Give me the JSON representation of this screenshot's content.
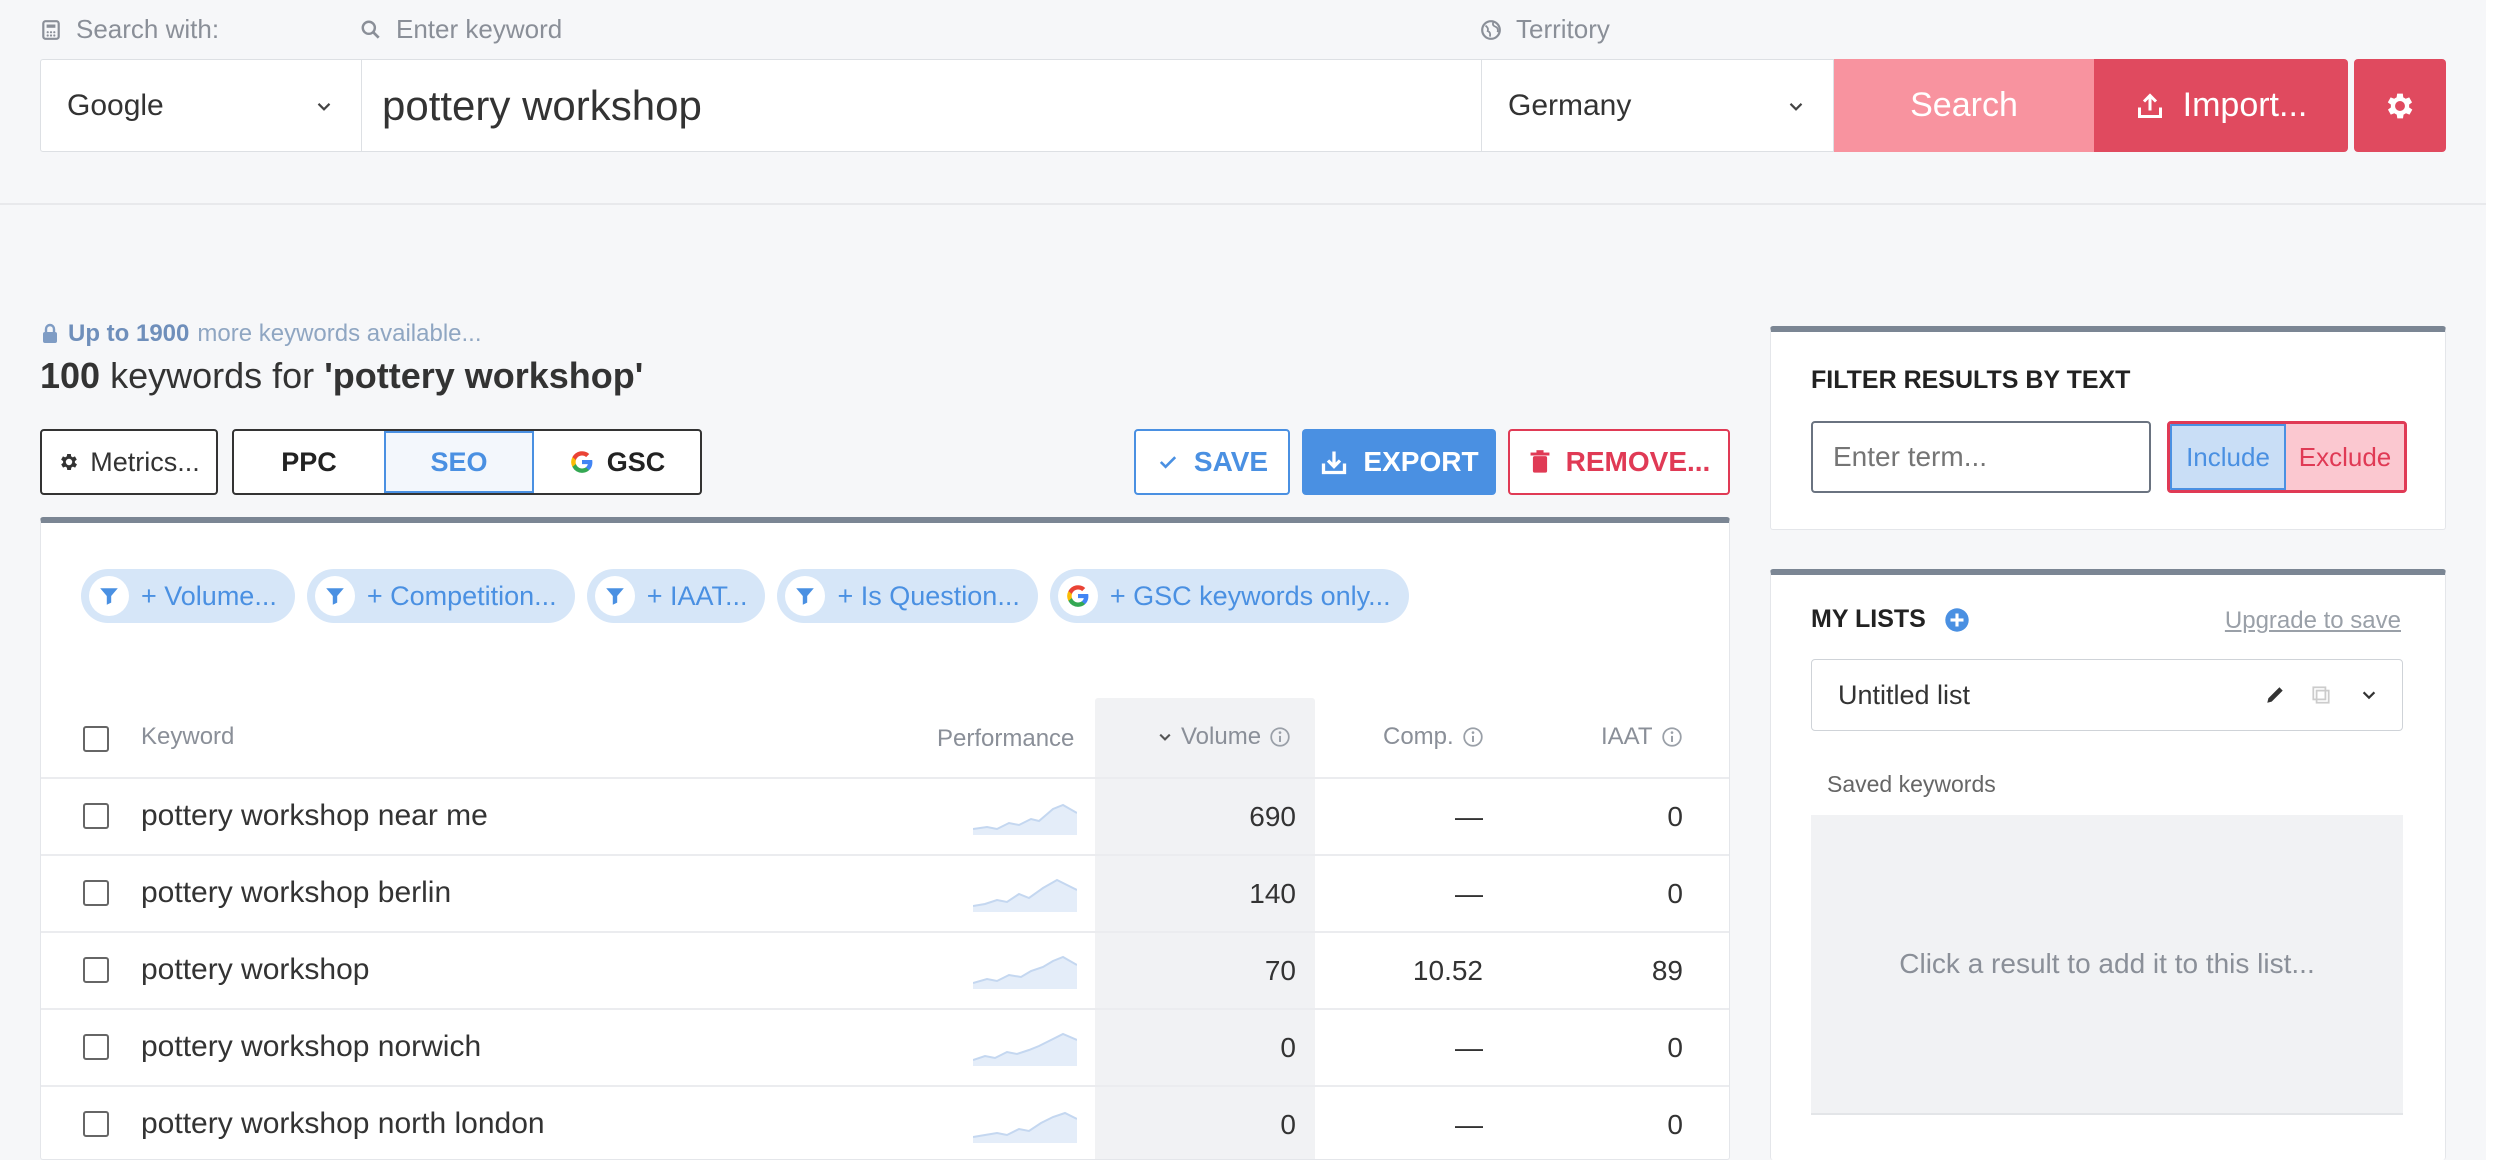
{
  "search": {
    "engine_label": "Search with:",
    "keyword_label": "Enter keyword",
    "territory_label": "Territory",
    "engine_value": "Google",
    "keyword_value": "pottery workshop",
    "territory_value": "Germany",
    "search_button": "Search",
    "import_button": "Import..."
  },
  "results": {
    "upto_bold": "Up to 1900",
    "upto_rest": "more keywords available...",
    "count": "100",
    "heading_mid": "keywords for",
    "heading_query": "'pottery workshop'",
    "metrics_button": "Metrics...",
    "tabs": [
      "PPC",
      "SEO",
      "GSC"
    ],
    "active_tab": "SEO",
    "save_button": "SAVE",
    "export_button": "EXPORT",
    "remove_button": "REMOVE..."
  },
  "filters": {
    "chips": [
      {
        "label": "+ Volume...",
        "icon": "filter-icon"
      },
      {
        "label": "+ Competition...",
        "icon": "filter-icon"
      },
      {
        "label": "+ IAAT...",
        "icon": "filter-icon"
      },
      {
        "label": "+ Is Question...",
        "icon": "filter-icon"
      },
      {
        "label": "+ GSC keywords only...",
        "icon": "google-icon"
      }
    ]
  },
  "table": {
    "columns": {
      "keyword": "Keyword",
      "performance": "Performance",
      "volume": "Volume",
      "comp": "Comp.",
      "iaat": "IAAT"
    },
    "rows": [
      {
        "keyword": "pottery workshop near me",
        "volume": "690",
        "comp": "—",
        "iaat": "0"
      },
      {
        "keyword": "pottery workshop berlin",
        "volume": "140",
        "comp": "—",
        "iaat": "0"
      },
      {
        "keyword": "pottery workshop",
        "volume": "70",
        "comp": "10.52",
        "iaat": "89"
      },
      {
        "keyword": "pottery workshop norwich",
        "volume": "0",
        "comp": "—",
        "iaat": "0"
      },
      {
        "keyword": "pottery workshop north london",
        "volume": "0",
        "comp": "—",
        "iaat": "0"
      }
    ]
  },
  "filter_panel": {
    "title": "FILTER RESULTS BY TEXT",
    "placeholder": "Enter term...",
    "include": "Include",
    "exclude": "Exclude"
  },
  "lists_panel": {
    "title": "MY LISTS",
    "upgrade_link": "Upgrade to save",
    "list_name": "Untitled list",
    "saved_label": "Saved keywords",
    "empty_message": "Click a result to add it to this list..."
  },
  "colors": {
    "accent_blue": "#4a90e2",
    "accent_red": "#e04a5f",
    "search_pink": "#f8939f"
  }
}
